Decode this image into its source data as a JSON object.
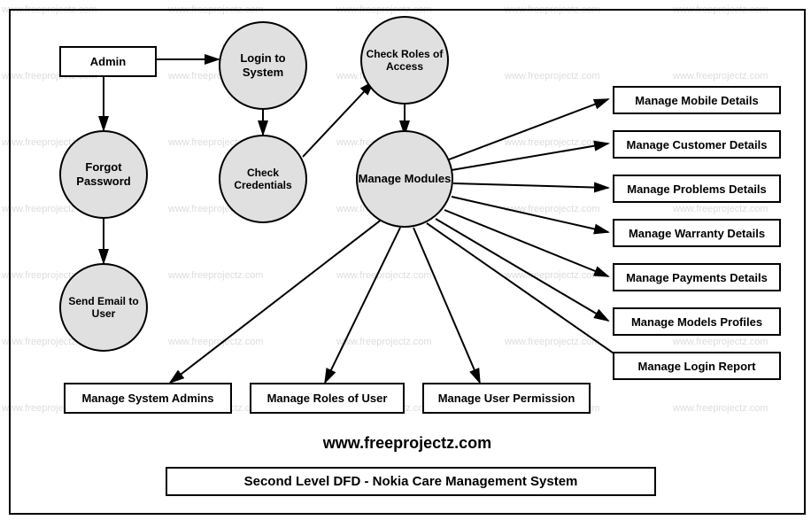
{
  "watermark": "www.freeprojectz.com",
  "entities": {
    "admin": "Admin",
    "mobile": "Manage Mobile Details",
    "customer": "Manage Customer Details",
    "problems": "Manage Problems Details",
    "warranty": "Manage Warranty Details",
    "payments": "Manage Payments Details",
    "models": "Manage Models Profiles",
    "login_report": "Manage Login  Report",
    "sys_admins": "Manage System Admins",
    "roles_user": "Manage Roles of User",
    "user_perm": "Manage User Permission"
  },
  "processes": {
    "login": "Login to System",
    "check_roles": "Check Roles of Access",
    "forgot": "Forgot Password",
    "check_cred": "Check Credentials",
    "manage_modules": "Manage Modules",
    "send_email": "Send Email to User"
  },
  "footer_url": "www.freeprojectz.com",
  "title": "Second Level DFD - Nokia Care Management System"
}
